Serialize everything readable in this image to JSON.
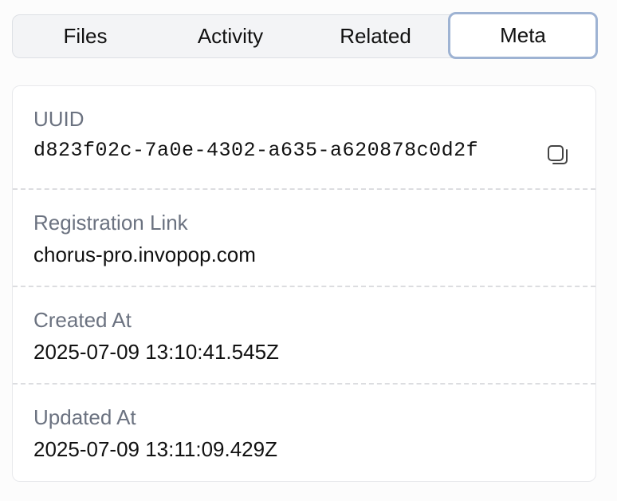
{
  "tabs": [
    {
      "label": "Files"
    },
    {
      "label": "Activity"
    },
    {
      "label": "Related"
    },
    {
      "label": "Meta",
      "active": true
    }
  ],
  "meta": {
    "uuid": {
      "label": "UUID",
      "value": "d823f02c-7a0e-4302-a635-a620878c0d2f",
      "action_icon": "copy-icon"
    },
    "registration_link": {
      "label": "Registration Link",
      "value": "chorus-pro.invopop.com"
    },
    "created_at": {
      "label": "Created At",
      "value": "2025-07-09 13:10:41.545Z"
    },
    "updated_at": {
      "label": "Updated At",
      "value": "2025-07-09 13:11:09.429Z"
    }
  },
  "colors": {
    "active_tab_border": "#9eb3d3",
    "label_text": "#6b7280",
    "divider": "#dcdde0"
  }
}
